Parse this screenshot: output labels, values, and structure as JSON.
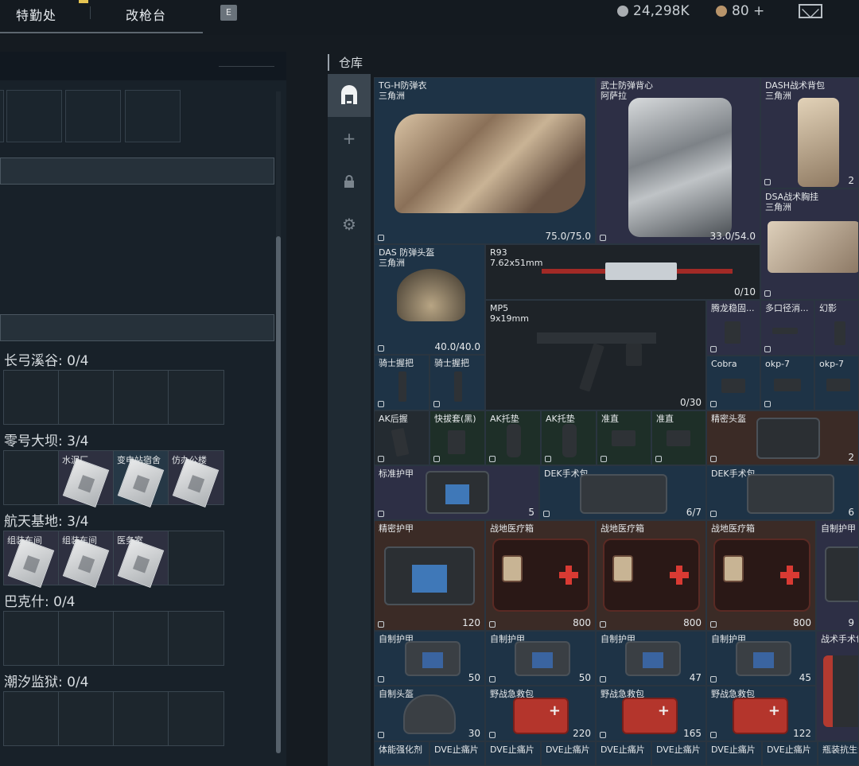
{
  "topbar": {
    "tabs": [
      "特勤处",
      "改枪台"
    ],
    "key_hint": "E",
    "currency": "24,298K",
    "tickets": "80 +"
  },
  "left": {
    "maps": [
      {
        "title": "长弓溪谷: 0/4",
        "cells": [
          "",
          "",
          "",
          ""
        ]
      },
      {
        "title": "零号大坝: 3/4",
        "cells": [
          "",
          "水泥厂",
          "变电站宿舍",
          "仿办公楼"
        ]
      },
      {
        "title": "航天基地: 3/4",
        "cells": [
          "组装车间",
          "组装车间",
          "医务室",
          ""
        ]
      },
      {
        "title": "巴克什: 0/4",
        "cells": [
          "",
          "",
          "",
          ""
        ]
      },
      {
        "title": "潮汐监狱: 0/4",
        "cells": [
          "",
          "",
          "",
          ""
        ]
      }
    ]
  },
  "storage": {
    "title": "仓库",
    "sidebar_icons": [
      "storage-icon",
      "plus-icon",
      "lock-icon",
      "gear-icon"
    ],
    "items": [
      {
        "name": "TG-H防弹衣\n三角洲",
        "value": "75.0/75.0"
      },
      {
        "name": "武士防弹背心\n阿萨拉",
        "value": "33.0/54.0"
      },
      {
        "name": "DASH战术背包\n三角洲",
        "value": "2"
      },
      {
        "name": "DSA战术胸挂\n三角洲",
        "value": ""
      },
      {
        "name": "DAS 防弹头盔\n三角洲",
        "value": "40.0/40.0"
      },
      {
        "name": "R93\n7.62x51mm",
        "value": "0/10"
      },
      {
        "name": "MP5\n9x19mm",
        "value": "0/30"
      },
      {
        "name": "腾龙稳固...",
        "value": ""
      },
      {
        "name": "多口径消...",
        "value": ""
      },
      {
        "name": "幻影",
        "value": ""
      },
      {
        "name": "骑士握把",
        "value": ""
      },
      {
        "name": "骑士握把",
        "value": ""
      },
      {
        "name": "Cobra",
        "value": ""
      },
      {
        "name": "okp-7",
        "value": ""
      },
      {
        "name": "okp-7",
        "value": ""
      },
      {
        "name": "AK后握",
        "value": ""
      },
      {
        "name": "快拔套(黑)",
        "value": ""
      },
      {
        "name": "AK托垫",
        "value": ""
      },
      {
        "name": "AK托垫",
        "value": ""
      },
      {
        "name": "准直",
        "value": ""
      },
      {
        "name": "准直",
        "value": ""
      },
      {
        "name": "精密头盔",
        "value": "2"
      },
      {
        "name": "标准护甲",
        "value": "5"
      },
      {
        "name": "DEK手术包",
        "value": "6/7"
      },
      {
        "name": "DEK手术包",
        "value": "6"
      },
      {
        "name": "精密护甲",
        "value": "120"
      },
      {
        "name": "战地医疗箱",
        "value": "800"
      },
      {
        "name": "战地医疗箱",
        "value": "800"
      },
      {
        "name": "战地医疗箱",
        "value": "800"
      },
      {
        "name": "自制护甲",
        "value": "9"
      },
      {
        "name": "自制护甲",
        "value": "50"
      },
      {
        "name": "自制护甲",
        "value": "50"
      },
      {
        "name": "自制护甲",
        "value": "47"
      },
      {
        "name": "自制护甲",
        "value": "45"
      },
      {
        "name": "战术手术包",
        "value": ""
      },
      {
        "name": "自制头盔",
        "value": "30"
      },
      {
        "name": "野战急救包",
        "value": "220"
      },
      {
        "name": "野战急救包",
        "value": "165"
      },
      {
        "name": "野战急救包",
        "value": "122"
      },
      {
        "name": "体能强化剂",
        "value": ""
      },
      {
        "name": "DVE止痛片",
        "value": ""
      },
      {
        "name": "DVE止痛片",
        "value": ""
      },
      {
        "name": "DVE止痛片",
        "value": ""
      },
      {
        "name": "DVE止痛片",
        "value": ""
      },
      {
        "name": "DVE止痛片",
        "value": ""
      },
      {
        "name": "DVE止痛片",
        "value": ""
      },
      {
        "name": "瓶装抗生素",
        "value": ""
      }
    ],
    "colors": {
      "blue": "#1e3346",
      "purple": "#2d2f45",
      "brown": "#3b2b26"
    }
  }
}
